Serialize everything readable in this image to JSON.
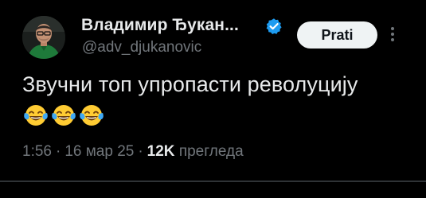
{
  "author": {
    "display_name": "Владимир Ђукан...",
    "username": "@adv_djukanovic",
    "verified": true
  },
  "follow_button": {
    "label": "Prati"
  },
  "tweet": {
    "text": "Звучни топ упропасти револуцију",
    "emojis": [
      "face-with-tears-of-joy",
      "face-with-tears-of-joy",
      "face-with-tears-of-joy"
    ]
  },
  "meta": {
    "time": "1:56",
    "separator": "·",
    "date": "16 мар 25",
    "views_count": "12K",
    "views_label": "прегледа"
  },
  "colors": {
    "background": "#000000",
    "primary_text": "#e7e9ea",
    "secondary_text": "#71767b",
    "verified_badge": "#1d9bf0",
    "button_bg": "#eff3f4",
    "button_text": "#0f1419"
  },
  "icons": {
    "verified": "verified-badge-icon",
    "more": "more-options-icon"
  }
}
